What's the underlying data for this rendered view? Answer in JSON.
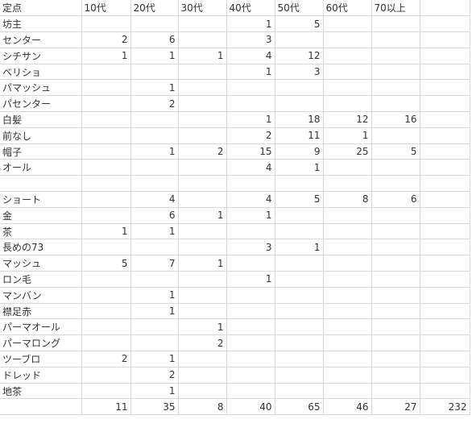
{
  "sheet": {
    "headers": [
      "定点",
      "10代",
      "20代",
      "30代",
      "40代",
      "50代",
      "60代",
      "70以上",
      ""
    ],
    "rows": [
      {
        "label": "坊主",
        "values": [
          "",
          "",
          "",
          "1",
          "5",
          "",
          "",
          ""
        ]
      },
      {
        "label": "センター",
        "values": [
          "2",
          "6",
          "",
          "3",
          "",
          "",
          "",
          ""
        ]
      },
      {
        "label": "シチサン",
        "values": [
          "1",
          "1",
          "1",
          "4",
          "12",
          "",
          "",
          ""
        ]
      },
      {
        "label": "ベリショ",
        "values": [
          "",
          "",
          "",
          "1",
          "3",
          "",
          "",
          ""
        ]
      },
      {
        "label": "パマッシュ",
        "values": [
          "",
          "1",
          "",
          "",
          "",
          "",
          "",
          ""
        ]
      },
      {
        "label": "パセンター",
        "values": [
          "",
          "2",
          "",
          "",
          "",
          "",
          "",
          ""
        ]
      },
      {
        "label": "白髪",
        "values": [
          "",
          "",
          "",
          "1",
          "18",
          "12",
          "16",
          ""
        ]
      },
      {
        "label": "前なし",
        "values": [
          "",
          "",
          "",
          "2",
          "11",
          "1",
          "",
          ""
        ]
      },
      {
        "label": "帽子",
        "values": [
          "",
          "1",
          "2",
          "15",
          "9",
          "25",
          "5",
          ""
        ]
      },
      {
        "label": "オール",
        "values": [
          "",
          "",
          "",
          "4",
          "1",
          "",
          "",
          ""
        ]
      },
      {
        "label": "",
        "values": [
          "",
          "",
          "",
          "",
          "",
          "",
          "",
          ""
        ]
      },
      {
        "label": "ショート",
        "values": [
          "",
          "4",
          "",
          "4",
          "5",
          "8",
          "6",
          ""
        ]
      },
      {
        "label": "金",
        "values": [
          "",
          "6",
          "1",
          "1",
          "",
          "",
          "",
          ""
        ]
      },
      {
        "label": "茶",
        "values": [
          "1",
          "1",
          "",
          "",
          "",
          "",
          "",
          ""
        ]
      },
      {
        "label": "長めの73",
        "values": [
          "",
          "",
          "",
          "3",
          "1",
          "",
          "",
          ""
        ]
      },
      {
        "label": "マッシュ",
        "values": [
          "5",
          "7",
          "1",
          "",
          "",
          "",
          "",
          ""
        ]
      },
      {
        "label": "ロン毛",
        "values": [
          "",
          "",
          "",
          "1",
          "",
          "",
          "",
          ""
        ]
      },
      {
        "label": "マンバン",
        "values": [
          "",
          "1",
          "",
          "",
          "",
          "",
          "",
          ""
        ]
      },
      {
        "label": "襟足赤",
        "values": [
          "",
          "1",
          "",
          "",
          "",
          "",
          "",
          ""
        ]
      },
      {
        "label": "パーマオール",
        "values": [
          "",
          "",
          "1",
          "",
          "",
          "",
          "",
          ""
        ]
      },
      {
        "label": "パーマロング",
        "values": [
          "",
          "",
          "2",
          "",
          "",
          "",
          "",
          ""
        ]
      },
      {
        "label": "ツーブロ",
        "values": [
          "2",
          "1",
          "",
          "",
          "",
          "",
          "",
          ""
        ]
      },
      {
        "label": "ドレッド",
        "values": [
          "",
          "2",
          "",
          "",
          "",
          "",
          "",
          ""
        ]
      },
      {
        "label": "地茶",
        "values": [
          "",
          "1",
          "",
          "",
          "",
          "",
          "",
          ""
        ]
      },
      {
        "label": "",
        "values": [
          "11",
          "35",
          "8",
          "40",
          "65",
          "46",
          "27",
          "232"
        ]
      }
    ]
  }
}
